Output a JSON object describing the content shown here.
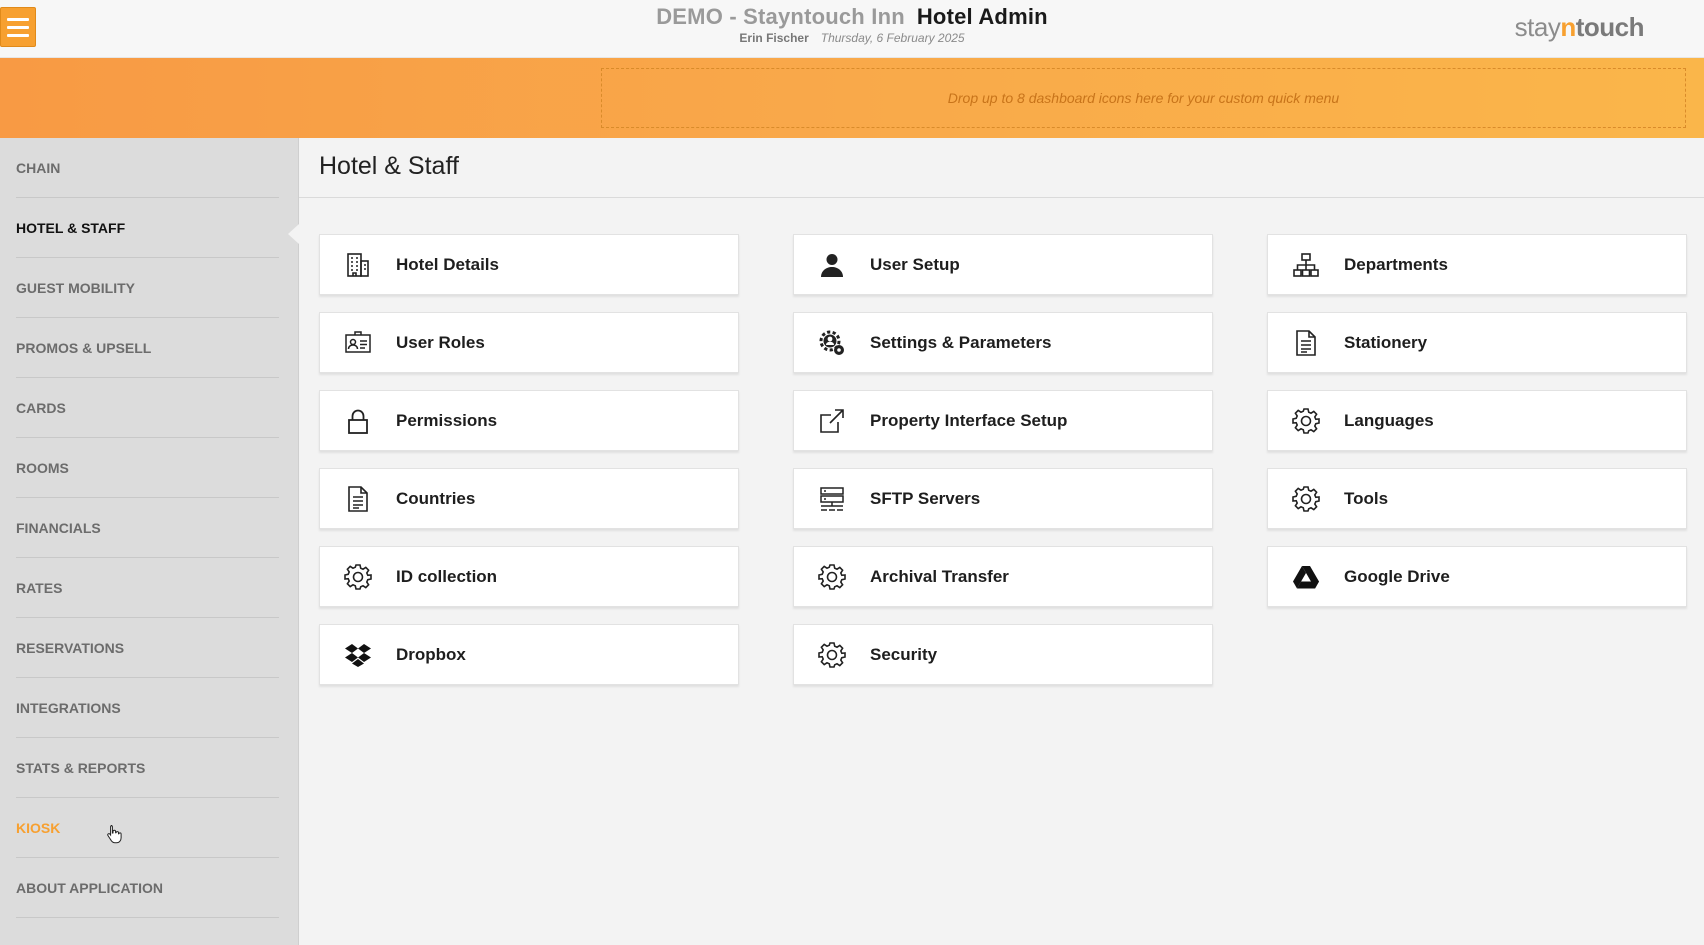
{
  "header": {
    "hotel_name": "DEMO - Stayntouch Inn",
    "app_name": "Hotel Admin",
    "user": "Erin Fischer",
    "date": "Thursday, 6 February 2025",
    "brand_stay": "stay",
    "brand_n": "n",
    "brand_touch": "touch"
  },
  "quick_menu": {
    "placeholder": "Drop up to 8 dashboard icons here for your custom quick menu"
  },
  "sidebar": {
    "items": [
      {
        "label": "CHAIN"
      },
      {
        "label": "HOTEL & STAFF"
      },
      {
        "label": "GUEST MOBILITY"
      },
      {
        "label": "PROMOS & UPSELL"
      },
      {
        "label": "CARDS"
      },
      {
        "label": "ROOMS"
      },
      {
        "label": "FINANCIALS"
      },
      {
        "label": "RATES"
      },
      {
        "label": "RESERVATIONS"
      },
      {
        "label": "INTEGRATIONS"
      },
      {
        "label": "STATS & REPORTS"
      },
      {
        "label": "KIOSK"
      },
      {
        "label": "ABOUT APPLICATION"
      }
    ],
    "active": "HOTEL & STAFF",
    "hovered": "KIOSK"
  },
  "main": {
    "title": "Hotel & Staff",
    "tiles": [
      {
        "label": "Hotel Details",
        "icon": "building-icon"
      },
      {
        "label": "User Setup",
        "icon": "user-icon"
      },
      {
        "label": "Departments",
        "icon": "org-chart-icon"
      },
      {
        "label": "User Roles",
        "icon": "id-card-icon"
      },
      {
        "label": "Settings & Parameters",
        "icon": "user-gear-icon"
      },
      {
        "label": "Stationery",
        "icon": "document-icon"
      },
      {
        "label": "Permissions",
        "icon": "lock-icon"
      },
      {
        "label": "Property Interface Setup",
        "icon": "external-link-icon"
      },
      {
        "label": "Languages",
        "icon": "gear-icon"
      },
      {
        "label": "Countries",
        "icon": "document-icon"
      },
      {
        "label": "SFTP Servers",
        "icon": "server-icon"
      },
      {
        "label": "Tools",
        "icon": "gear-icon"
      },
      {
        "label": "ID collection",
        "icon": "gear-icon"
      },
      {
        "label": "Archival Transfer",
        "icon": "gear-icon"
      },
      {
        "label": "Google Drive",
        "icon": "google-drive-icon"
      },
      {
        "label": "Dropbox",
        "icon": "dropbox-icon"
      },
      {
        "label": "Security",
        "icon": "gear-icon"
      }
    ]
  },
  "colors": {
    "accent": "#f7a030",
    "band_start": "#f89a44",
    "band_end": "#fab64a"
  }
}
